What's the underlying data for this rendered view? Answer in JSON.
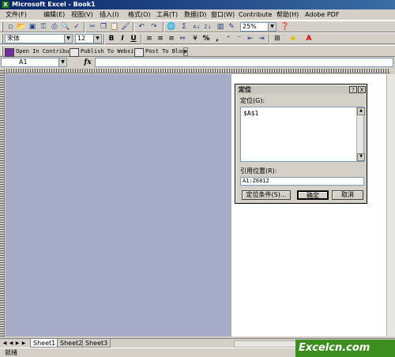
{
  "window": {
    "title": "Microsoft Excel - Book1",
    "app_icon": "X"
  },
  "menu": [
    "文件(F)",
    "编辑(E)",
    "视图(V)",
    "插入(I)",
    "格式(O)",
    "工具(T)",
    "数据(D)",
    "窗口(W)",
    "Contribute",
    "帮助(H)",
    "Adobe PDF"
  ],
  "toolbar": {
    "zoom": "25%",
    "font_name": "宋体",
    "font_size": "12",
    "bold": "B",
    "italic": "I",
    "underline": "U",
    "percent": "%",
    "comma": ",",
    "sum": "Σ",
    "sort_asc": "A↓",
    "sort_desc": "Z↓"
  },
  "contribute_bar": {
    "open": "Open In Contribute",
    "publish": "Publish To Website",
    "blog": "Post To Blog"
  },
  "formula_bar": {
    "name_box": "A1",
    "fx": "fx",
    "formula": ""
  },
  "sheets": [
    "Sheet1",
    "Sheet2",
    "Sheet3"
  ],
  "active_sheet": "Sheet1",
  "status": {
    "text": "就绪"
  },
  "logo": {
    "text": "Excelcn.com"
  },
  "dialog": {
    "title": "定位",
    "help_label": "?",
    "close_label": "X",
    "goto_label": "定位(G):",
    "goto_items": [
      "$A$1"
    ],
    "reference_label": "引用位置(R):",
    "reference_value": "A1:Z6812",
    "special_button": "定位条件(S)...",
    "ok_button": "确定",
    "cancel_button": "取消"
  },
  "colors": {
    "sheet_fill": "#a6acc8",
    "titlebar_start": "#0a246a",
    "logo_bg": "#3c8f1f"
  }
}
